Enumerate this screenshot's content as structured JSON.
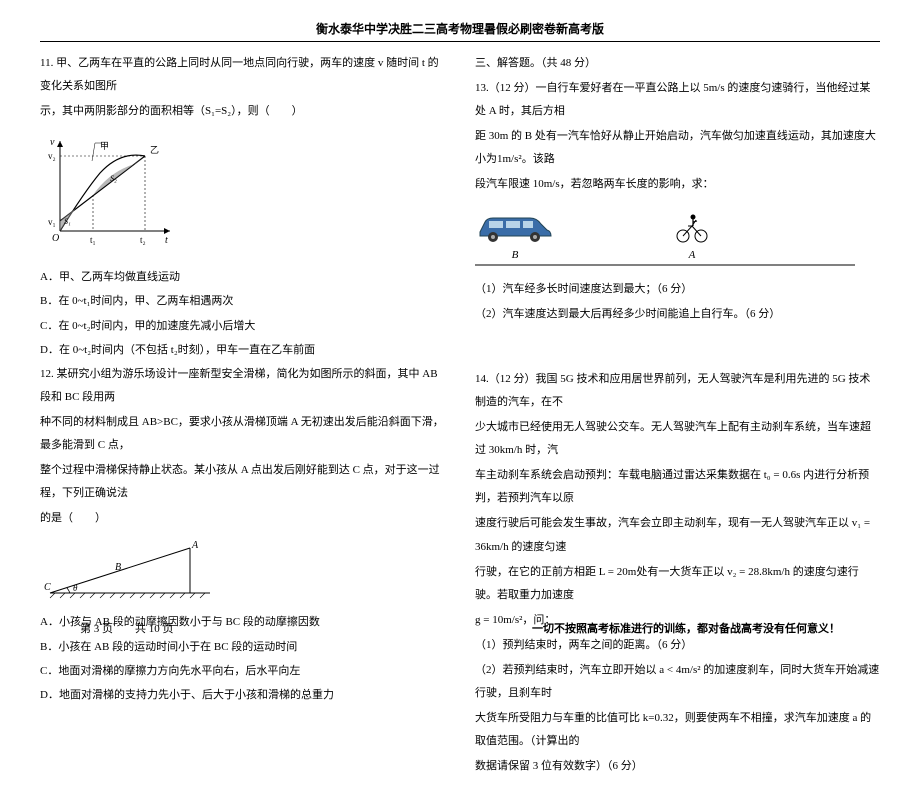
{
  "header": "衡水泰华中学决胜二三高考物理暑假必刷密卷新高考版",
  "q11": {
    "stem1": "11. 甲、乙两车在平直的公路上同时从同一地点同向行驶，两车的速度 v 随时间 t 的变化关系如图所",
    "stem2": "示，其中两阴影部分的面积相等（S₁=S₂），则（　　）",
    "optA": "A．甲、乙两车均做直线运动",
    "optB": "B．在 0~t₁时间内，甲、乙两车相遇两次",
    "optC": "C．在 0~t₂时间内，甲的加速度先减小后增大",
    "optD": "D．在 0~t₂时间内（不包括 t₂时刻），甲车一直在乙车前面",
    "graph": {
      "yLabel": "v",
      "xLabel": "t",
      "v1": "v₁",
      "v2": "v₂",
      "t1": "t₁",
      "t2": "t₂",
      "O": "O",
      "s1": "S₁",
      "s2": "S₂",
      "caption_jia": "甲",
      "caption_yi": "乙"
    }
  },
  "q12": {
    "stem1": "12. 某研究小组为游乐场设计一座新型安全滑梯，简化为如图所示的斜面，其中 AB 段和 BC 段用两",
    "stem2": "种不同的材料制成且 AB>BC，要求小孩从滑梯顶端 A 无初速出发后能沿斜面下滑，最多能滑到 C 点，",
    "stem3": "整个过程中滑梯保持静止状态。某小孩从 A 点出发后刚好能到达 C 点，对于这一过程，下列正确说法",
    "stem4": "的是（　　）",
    "optA": "A．小孩与 AB 段的动摩擦因数小于与 BC 段的动摩擦因数",
    "optB": "B．小孩在 AB 段的运动时间小于在 BC 段的运动时间",
    "optC": "C．地面对滑梯的摩擦力方向先水平向右，后水平向左",
    "optD": "D．地面对滑梯的支持力先小于、后大于小孩和滑梯的总重力",
    "labels": {
      "A": "A",
      "B": "B",
      "C": "C",
      "theta": "θ"
    }
  },
  "section3": "三、解答题。（共 48 分）",
  "q13": {
    "stem1": "13.（12 分）一自行车爱好者在一平直公路上以 5m/s 的速度匀速骑行，当他经过某处 A 时，其后方相",
    "stem2": "距 30m 的 B 处有一汽车恰好从静止开始启动，汽车做匀加速直线运动，其加速度大小为1m/s²。该路",
    "stem3": "段汽车限速 10m/s，若忽略两车长度的影响，求：",
    "labels": {
      "A": "A",
      "B": "B"
    },
    "part1": "（1）汽车经多长时间速度达到最大；（6 分）",
    "part2": "（2）汽车速度达到最大后再经多少时间能追上自行车。（6 分）"
  },
  "q14": {
    "stem1": "14.（12 分）我国 5G 技术和应用居世界前列，无人驾驶汽车是利用先进的 5G 技术制造的汽车，在不",
    "stem2": "少大城市已经使用无人驾驶公交车。无人驾驶汽车上配有主动刹车系统，当车速超过 30km/h 时，汽",
    "stem3": "车主动刹车系统会启动预判：车载电脑通过雷达采集数据在 t₀ = 0.6s 内进行分析预判，若预判汽车以原",
    "stem4": "速度行驶后可能会发生事故，汽车会立即主动刹车，现有一无人驾驶汽车正以 v₁ = 36km/h 的速度匀速",
    "stem5": "行驶，在它的正前方相距 L = 20m处有一大货车正以 v₂ = 28.8km/h 的速度匀速行驶。若取重力加速度",
    "stem6": "g = 10m/s²，问：",
    "part1": "（1）预判结束时，两车之间的距离。（6 分）",
    "part2a": "（2）若预判结束时，汽车立即开始以 a < 4m/s² 的加速度刹车，同时大货车开始减速行驶，且刹车时",
    "part2b": "大货车所受阻力与车重的比值可比 k=0.32，则要使两车不相撞，求汽车加速度 a 的取值范围。（计算出的",
    "part2c": "数据请保留 3 位有效数字）（6 分）"
  },
  "footer": {
    "left": "第 3 页　　共 10 页",
    "right": "一切不按照高考标准进行的训练，都对备战高考没有任何意义！"
  }
}
